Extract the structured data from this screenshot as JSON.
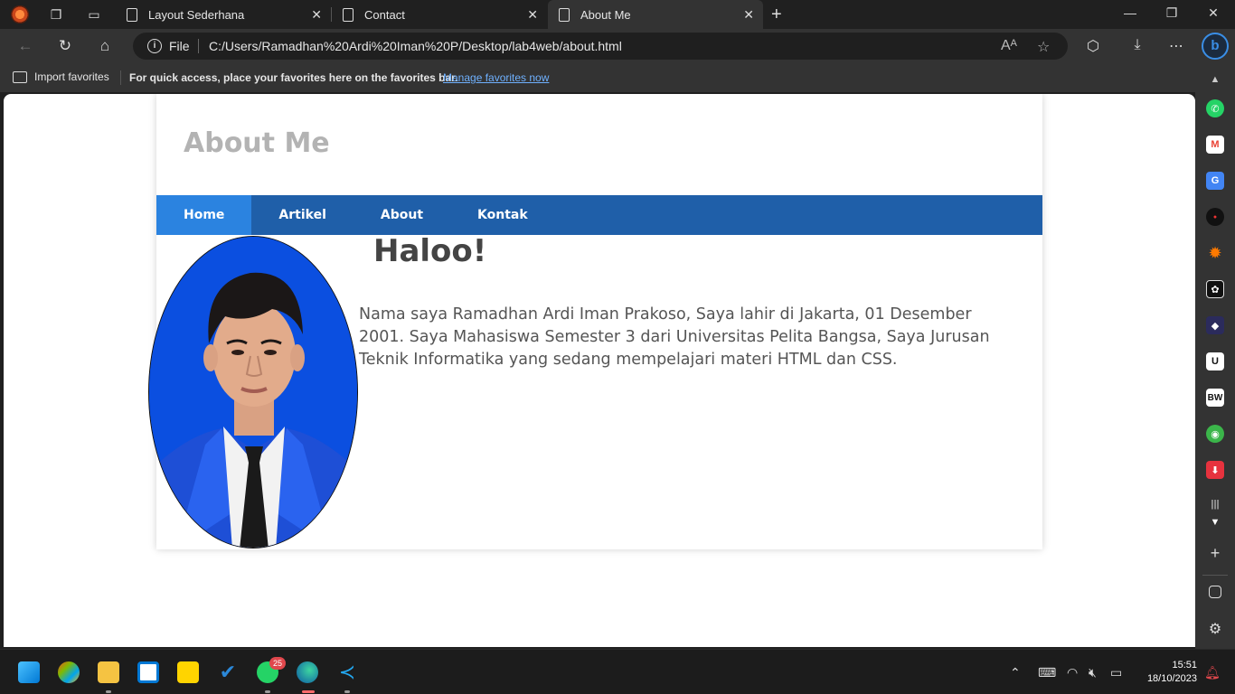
{
  "browser": {
    "tabs": [
      {
        "title": "Layout Sederhana",
        "active": false
      },
      {
        "title": "Contact",
        "active": false
      },
      {
        "title": "About Me",
        "active": true
      }
    ],
    "address": {
      "scheme_label": "File",
      "url": "C:/Users/Ramadhan%20Ardi%20Iman%20P/Desktop/lab4web/about.html"
    },
    "favorites_bar": {
      "import_label": "Import favorites",
      "hint": "For quick access, place your favorites here on the favorites bar.",
      "manage_link": "Manage favorites now"
    }
  },
  "page": {
    "site_title": "About Me",
    "nav": [
      "Home",
      "Artikel",
      "About",
      "Kontak"
    ],
    "active_nav": "Home",
    "heading": "Haloo!",
    "paragraph": "Nama saya Ramadhan Ardi Iman Prakoso, Saya lahir di Jakarta, 01 Desember 2001. Saya Mahasiswa Semester 3 dari Universitas Pelita Bangsa, Saya Jurusan Teknik Informatika yang sedang mempelajari materi HTML dan CSS."
  },
  "sidebar_icons": [
    "whatsapp-icon",
    "gmail-icon",
    "google-translate-icon",
    "app-icon",
    "settings-sun-icon",
    "openai-icon",
    "app-icon",
    "app-icon",
    "app-icon",
    "owl-icon",
    "download-icon",
    "audio-icon"
  ],
  "taskbar": {
    "whatsapp_badge": "25",
    "time": "15:51",
    "date": "18/10/2023"
  },
  "colors": {
    "nav_bg": "#1f5fa9",
    "nav_active": "#2b83e0",
    "title_gray": "#b3b3b3",
    "photo_bg": "#0b4fe0"
  }
}
